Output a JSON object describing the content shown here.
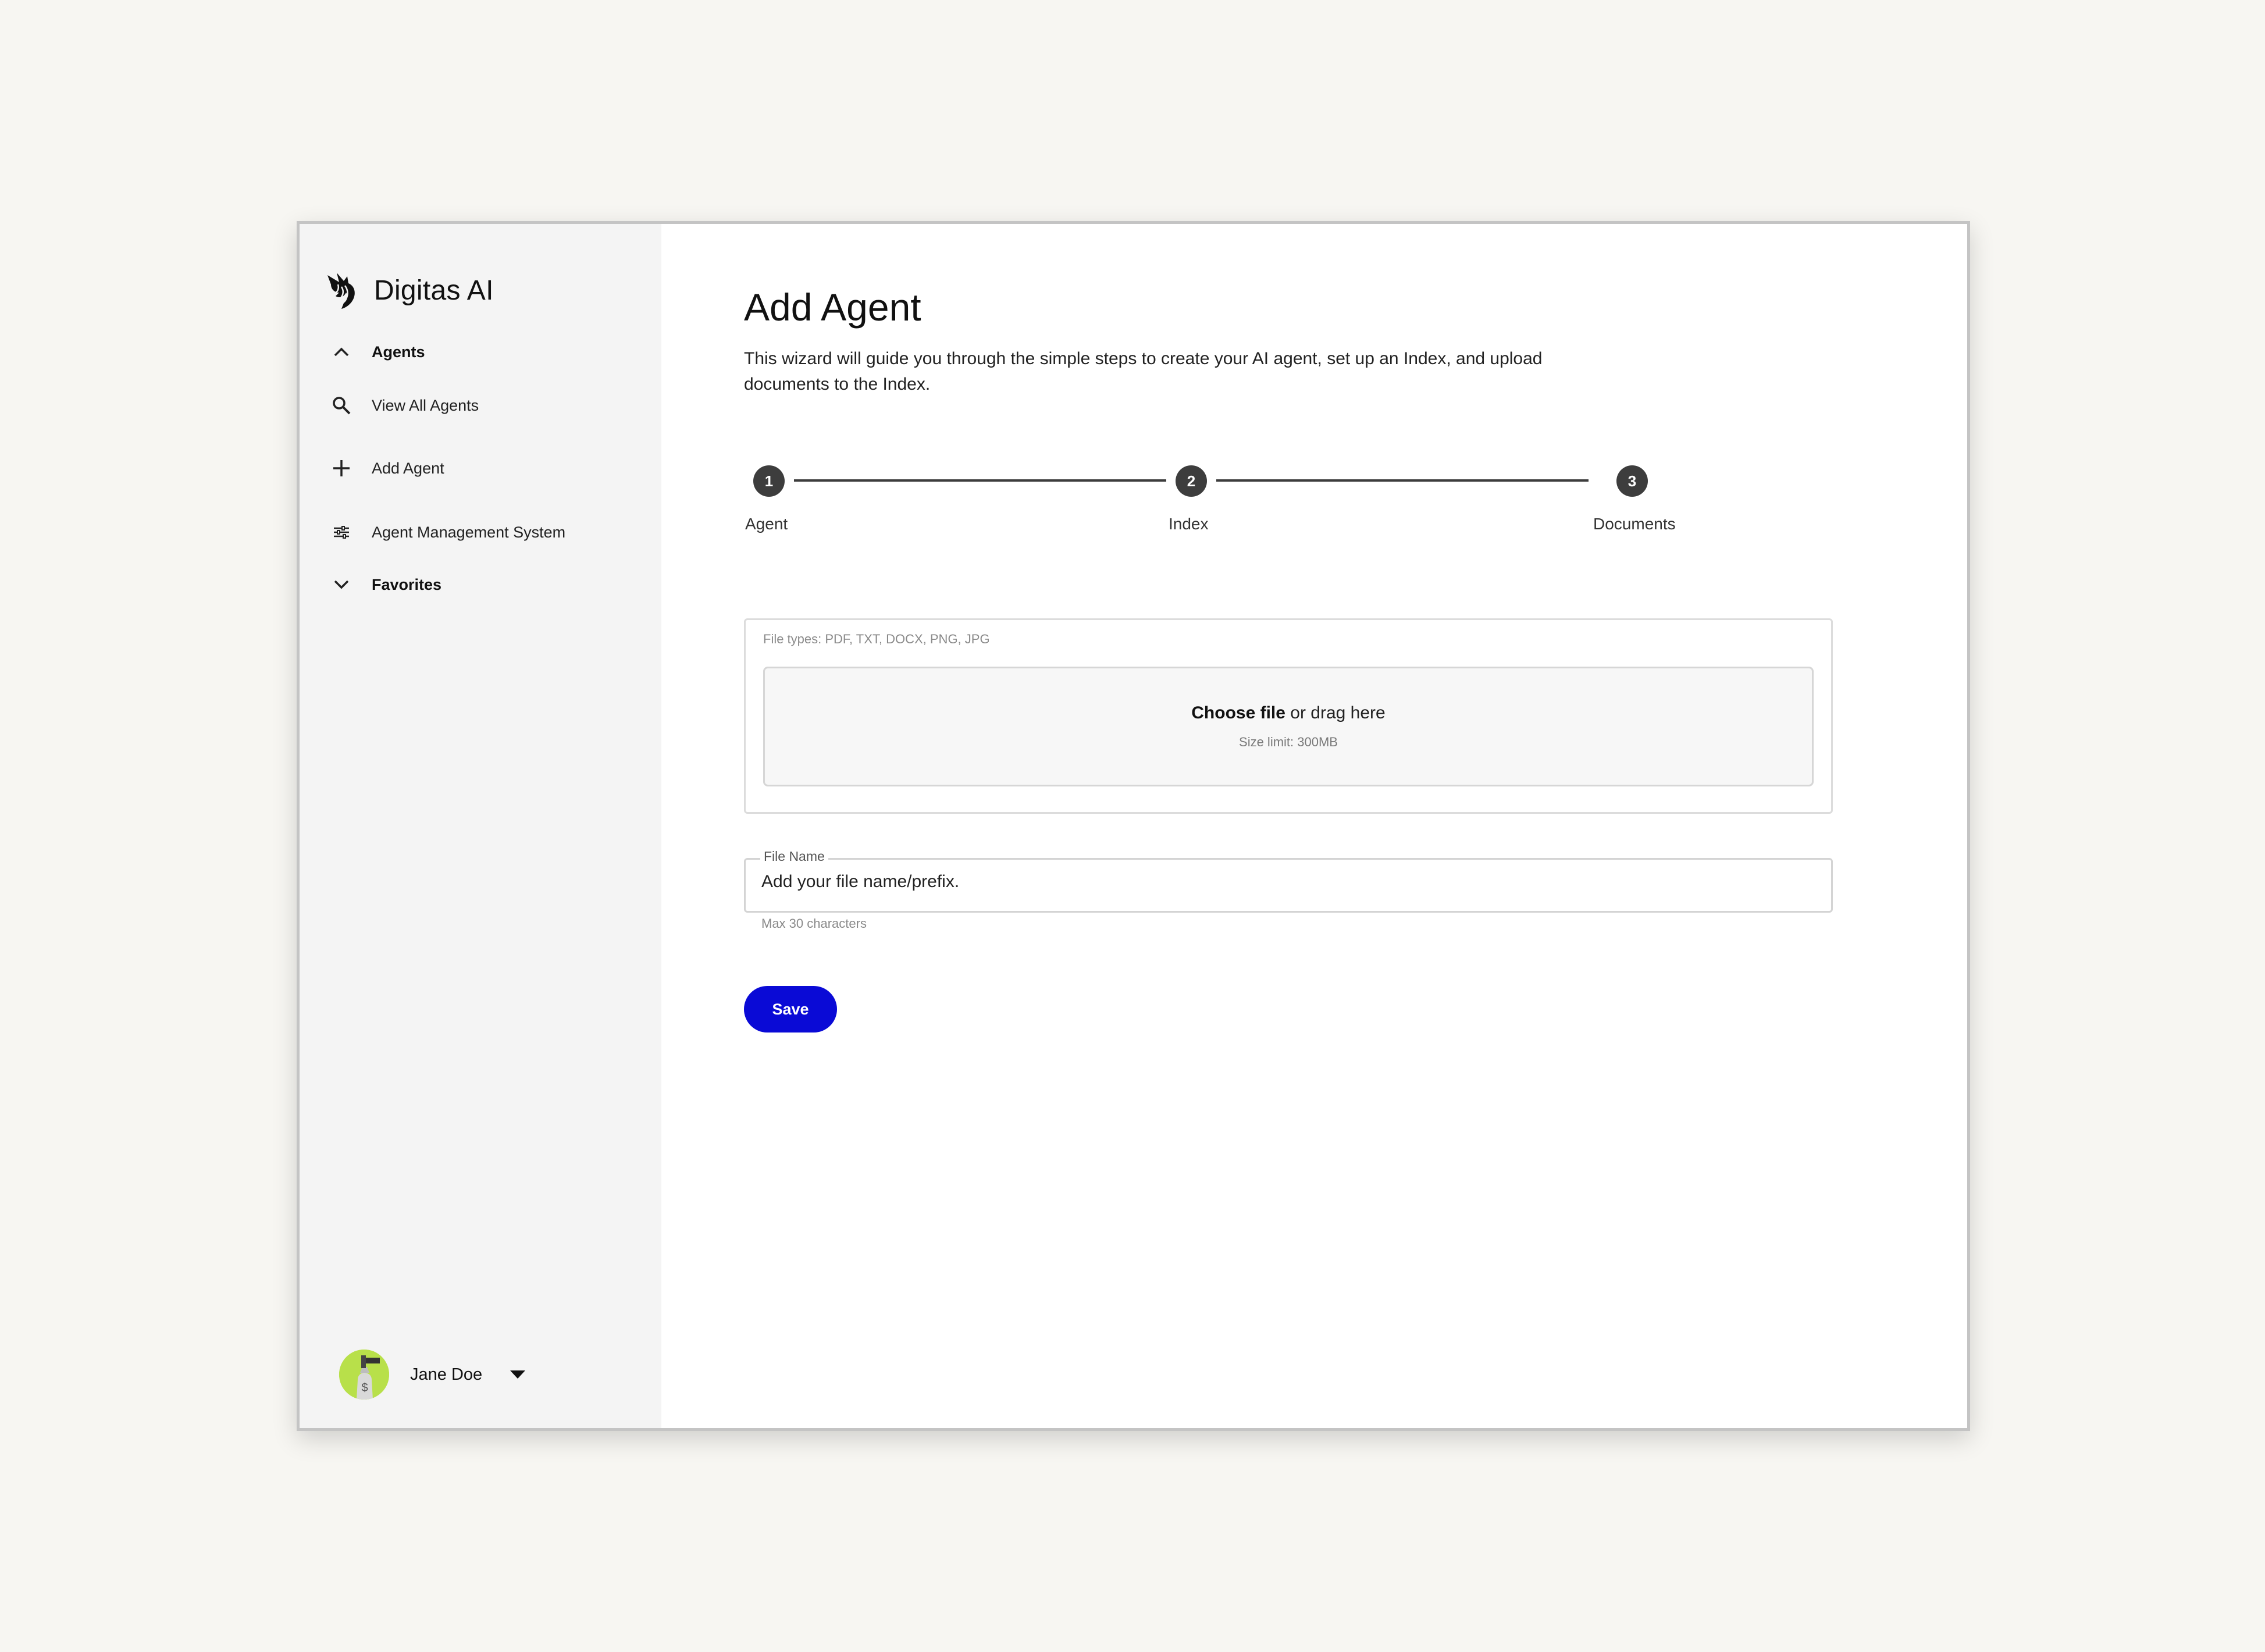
{
  "app": {
    "brand_name": "Digitas AI",
    "logo_icon": "unicorn-logo-icon"
  },
  "sidebar": {
    "items": [
      {
        "label": "Agents",
        "icon": "chevron-up-icon",
        "bold": true
      },
      {
        "label": "View All Agents",
        "icon": "search-icon",
        "bold": false
      },
      {
        "label": "Add Agent",
        "icon": "plus-icon",
        "bold": false
      },
      {
        "label": "Agent Management System",
        "icon": "sliders-icon",
        "bold": false
      },
      {
        "label": "Favorites",
        "icon": "chevron-down-icon",
        "bold": true
      }
    ]
  },
  "user": {
    "name": "Jane Doe",
    "menu_icon": "caret-down-icon",
    "avatar_color": "#b8e04a"
  },
  "main": {
    "title": "Add Agent",
    "description": "This wizard will guide you through the simple steps to create your AI agent, set up an Index, and upload documents to the Index."
  },
  "stepper": {
    "steps": [
      {
        "number": "1",
        "label": "Agent"
      },
      {
        "number": "2",
        "label": "Index"
      },
      {
        "number": "3",
        "label": "Documents"
      }
    ]
  },
  "upload": {
    "file_types": "File types: PDF, TXT, DOCX, PNG, JPG",
    "choose_file": "Choose file",
    "drag_text": " or drag here",
    "size_limit": "Size limit: 300MB"
  },
  "file_name": {
    "label": "File Name",
    "placeholder": "Add your file name/prefix.",
    "value": "",
    "helper": "Max 30 characters"
  },
  "actions": {
    "save_label": "Save"
  },
  "colors": {
    "primary_button": "#0a0ad6",
    "step_active": "#3d3d3d",
    "sidebar_bg": "#f4f4f4"
  }
}
